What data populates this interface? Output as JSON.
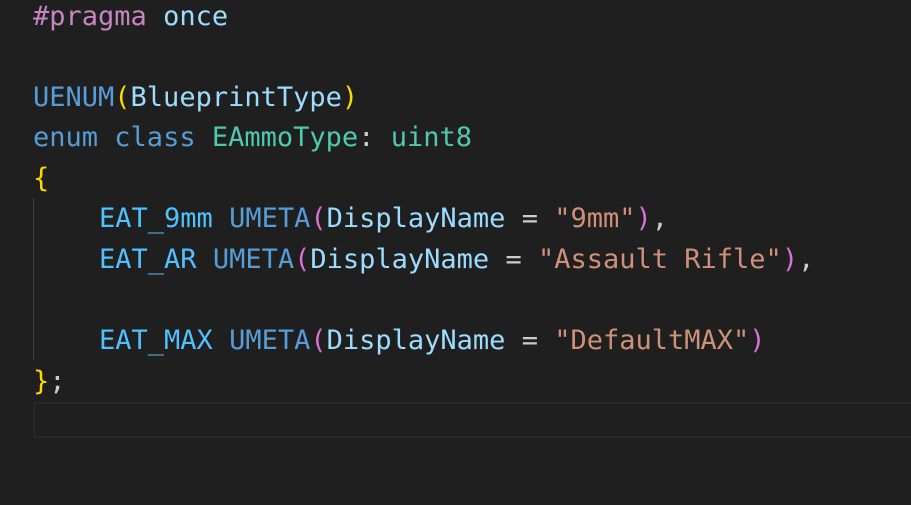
{
  "code": {
    "line1": {
      "directive": "#pragma",
      "arg": "once"
    },
    "line3": {
      "macro": "UENUM",
      "open": "(",
      "arg": "BlueprintType",
      "close": ")"
    },
    "line4": {
      "kw1": "enum",
      "kw2": "class",
      "name": "EAmmoType",
      "colon": ":",
      "base": "uint8"
    },
    "line5": {
      "brace": "{"
    },
    "line6": {
      "enumerator": "EAT_9mm",
      "meta": "UMETA",
      "open": "(",
      "key": "DisplayName",
      "eq": "=",
      "value": "\"9mm\"",
      "close": ")",
      "comma": ","
    },
    "line7": {
      "enumerator": "EAT_AR",
      "meta": "UMETA",
      "open": "(",
      "key": "DisplayName",
      "eq": "=",
      "value": "\"Assault Rifle\"",
      "close": ")",
      "comma": ","
    },
    "line9": {
      "enumerator": "EAT_MAX",
      "meta": "UMETA",
      "open": "(",
      "key": "DisplayName",
      "eq": "=",
      "value": "\"DefaultMAX\"",
      "close": ")"
    },
    "line10": {
      "brace": "}",
      "semi": ";"
    }
  },
  "colors": {
    "background": "#1f1f1f",
    "macro": "#c586c0",
    "keyword": "#569cd6",
    "type": "#4ec9b0",
    "identifier": "#9cdcfe",
    "enum_member": "#4fc1ff",
    "string": "#ce9178",
    "bracket_gold": "#ffd700",
    "bracket_pink": "#da70d6",
    "bracket_blue": "#179fff"
  }
}
